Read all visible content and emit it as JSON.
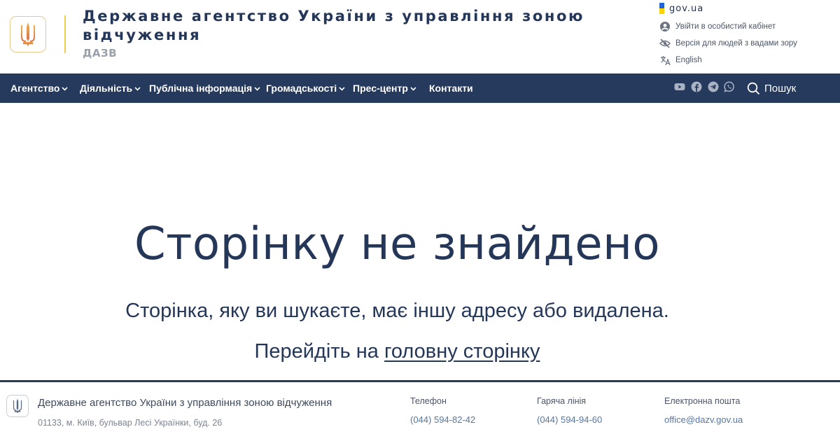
{
  "header": {
    "title": "Державне агентство України з управління зоною відчуження",
    "abbr": "ДАЗВ",
    "gov_link": "gov.ua",
    "cabinet_link": "Увійти в особистий кабінет",
    "accessibility_link": "Версія для людей з вадами зору",
    "language_link": "English"
  },
  "nav": {
    "items": [
      {
        "label": "Агентство"
      },
      {
        "label": "Діяльність"
      },
      {
        "label": "Публічна інформація"
      },
      {
        "label": "Громадськості"
      },
      {
        "label": "Прес-центр"
      },
      {
        "label": "Контакти"
      }
    ],
    "social_icons": [
      "youtube-icon",
      "facebook-icon",
      "telegram-icon",
      "whatsapp-icon"
    ],
    "search_label": "Пошук"
  },
  "main": {
    "title": "Сторінку не знайдено",
    "subtitle": "Сторінка, яку ви шукаєте, має іншу адресу або видалена.",
    "goto_prefix": "Перейдіть на",
    "home_link": "головну сторінку"
  },
  "footer": {
    "org_name": "Державне агентство України з управління зоною відчуження",
    "address": "01133, м. Київ, бульвар Лесі Українки, буд. 26",
    "phone_label": "Телефон",
    "phone": "(044) 594-82-42",
    "hotline_label": "Гаряча лінія",
    "hotline": "(044) 594-94-60",
    "email_label": "Електронна пошта",
    "email": "office@dazv.gov.ua"
  },
  "colors": {
    "nav_bg": "#263a5d",
    "title": "#253758",
    "accent_gold": "#f2cc4d",
    "link_blue": "#5576a3"
  }
}
